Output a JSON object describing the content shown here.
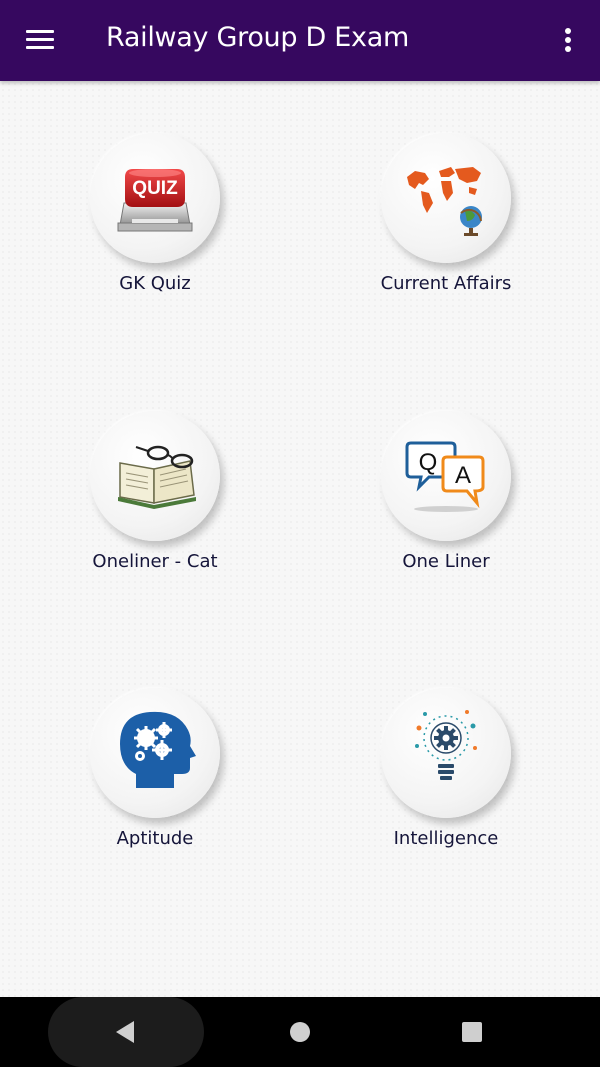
{
  "app": {
    "title": "Railway Group D Exam",
    "menu_icon": "hamburger-menu-icon",
    "overflow_icon": "more-vertical-icon",
    "header_color": "#36085f"
  },
  "tiles": [
    {
      "label": "GK Quiz",
      "icon": "quiz-button-icon"
    },
    {
      "label": "Current Affairs",
      "icon": "world-map-globe-icon"
    },
    {
      "label": "Oneliner - Cat",
      "icon": "book-glasses-icon"
    },
    {
      "label": "One Liner",
      "icon": "qa-speech-bubbles-icon"
    },
    {
      "label": "Aptitude",
      "icon": "head-gears-icon"
    },
    {
      "label": "Intelligence",
      "icon": "lightbulb-gear-icon"
    }
  ],
  "quiz_icon_text": "QUIZ",
  "qa_icon_letters": {
    "q": "Q",
    "a": "A"
  },
  "system_nav": {
    "back_icon": "back-triangle-icon",
    "home_icon": "home-circle-icon",
    "recents_icon": "recents-square-icon"
  }
}
